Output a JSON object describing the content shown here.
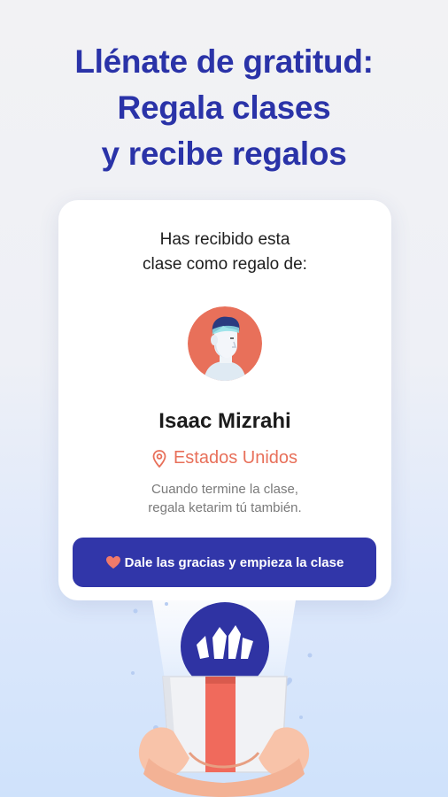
{
  "headline": {
    "line1": "Llénate de gratitud:",
    "line2": "Regala clases",
    "line3": "y recibe regalos"
  },
  "card": {
    "intro_line1": "Has recibido esta",
    "intro_line2": "clase como regalo de:",
    "sender_name": "Isaac Mizrahi",
    "location": "Estados Unidos",
    "note_line1": "Cuando termine la clase,",
    "note_line2": "regala ketarim tú también.",
    "cta_label": "Dale las gracias y empieza la clase"
  },
  "colors": {
    "headline": "#2a33a8",
    "button": "#3136a9",
    "accent_coral": "#e8705a",
    "heart": "#f07a6a"
  },
  "icons": [
    "avatar",
    "location-pin-icon",
    "heart-icon",
    "gift-box-illustration"
  ]
}
